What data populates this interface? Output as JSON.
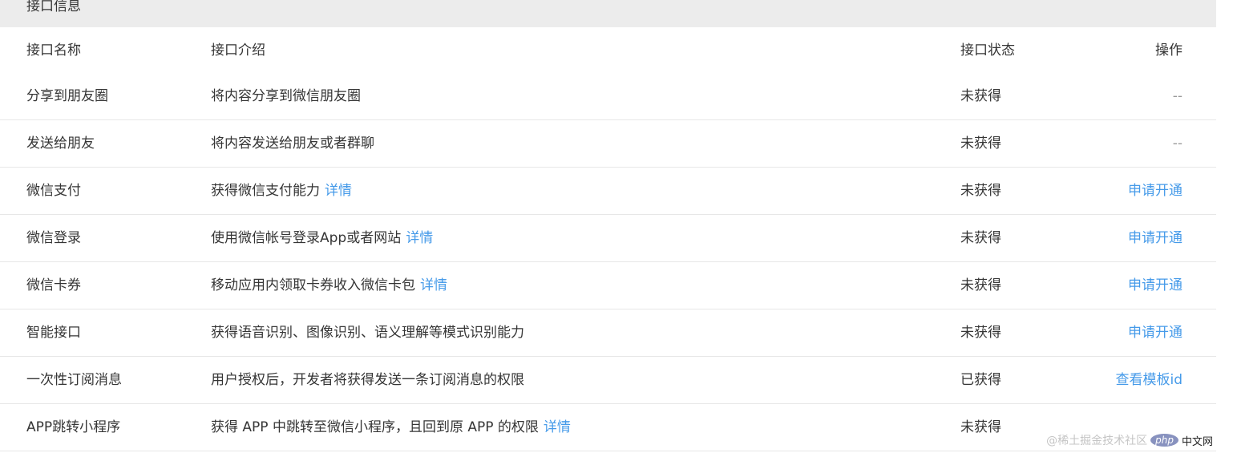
{
  "section": {
    "title": "接口信息"
  },
  "columns": {
    "name": "接口名称",
    "desc": "接口介绍",
    "status": "接口状态",
    "action": "操作"
  },
  "rows": [
    {
      "name": "分享到朋友圈",
      "desc": "将内容分享到微信朋友圈",
      "desc_link": "",
      "status": "未获得",
      "action": "--"
    },
    {
      "name": "发送给朋友",
      "desc": "将内容发送给朋友或者群聊",
      "desc_link": "",
      "status": "未获得",
      "action": "--"
    },
    {
      "name": "微信支付",
      "desc": "获得微信支付能力",
      "desc_link": "详情",
      "status": "未获得",
      "action": "申请开通"
    },
    {
      "name": "微信登录",
      "desc": "使用微信帐号登录App或者网站",
      "desc_link": "详情",
      "status": "未获得",
      "action": "申请开通"
    },
    {
      "name": "微信卡券",
      "desc": "移动应用内领取卡券收入微信卡包",
      "desc_link": "详情",
      "status": "未获得",
      "action": "申请开通"
    },
    {
      "name": "智能接口",
      "desc": "获得语音识别、图像识别、语义理解等模式识别能力",
      "desc_link": "",
      "status": "未获得",
      "action": "申请开通"
    },
    {
      "name": "一次性订阅消息",
      "desc": "用户授权后，开发者将获得发送一条订阅消息的权限",
      "desc_link": "",
      "status": "已获得",
      "action": "查看模板id"
    },
    {
      "name": "APP跳转小程序",
      "desc": "获得 APP 中跳转至微信小程序，且回到原 APP 的权限",
      "desc_link": "详情",
      "status": "未获得",
      "action": ""
    }
  ],
  "watermark": {
    "badge": "php",
    "label": "中文网",
    "text": "@稀土掘金技术社区"
  },
  "colors": {
    "link": "#459ae9",
    "header_bg": "#ececec",
    "text": "#353535"
  }
}
